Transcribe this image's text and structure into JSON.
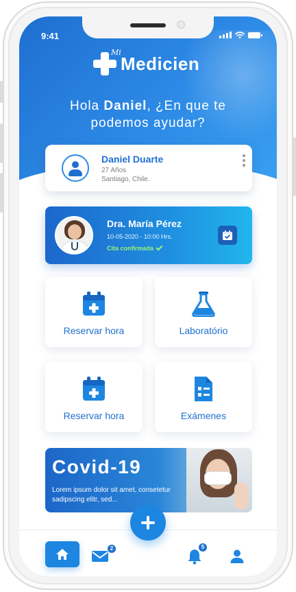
{
  "status_bar": {
    "time": "9:41"
  },
  "brand": {
    "prefix": "Mi",
    "name": "Medicien"
  },
  "greeting": {
    "hello": "Hola",
    "user": "Daniel",
    "rest_line1": ", ¿En que te",
    "line2": "podemos ayudar?"
  },
  "profile": {
    "name": "Daniel Duarte",
    "age": "27 Años",
    "location": "Santiago, Chile."
  },
  "appointment": {
    "doctor": "Dra. María Pérez",
    "datetime": "10-05-2020 - 10:00 Hrs.",
    "status": "Cita confirmada"
  },
  "tiles": [
    {
      "label": "Reservar hora",
      "icon": "calendar-plus-icon"
    },
    {
      "label": "Laboratório",
      "icon": "flask-icon"
    },
    {
      "label": "Reservar hora",
      "icon": "calendar-plus-icon"
    },
    {
      "label": "Exámenes",
      "icon": "document-icon"
    }
  ],
  "covid_banner": {
    "title": "Covid-19",
    "text": "Lorem ipsum dolor sit amet, consetetur sadipscing elitr, sed..."
  },
  "bottom_nav": {
    "messages_badge": "2",
    "notifications_badge": "5"
  },
  "colors": {
    "primary": "#1f6fd0",
    "accent": "#1d86e0",
    "confirmed": "#9cf07a"
  }
}
